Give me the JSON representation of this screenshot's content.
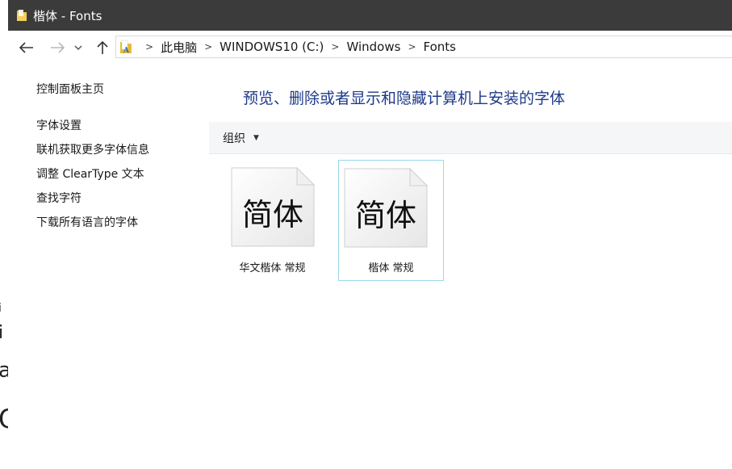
{
  "window": {
    "title": "楷体 - Fonts"
  },
  "background_app": {
    "fragments": [
      "a",
      "i",
      "i",
      "a",
      "O"
    ]
  },
  "navigation": {
    "back_icon": "arrow-left-icon",
    "forward_icon": "arrow-right-icon",
    "recent_icon": "chevron-down-icon",
    "up_icon": "arrow-up-icon",
    "breadcrumbs": [
      "此电脑",
      "WINDOWS10 (C:)",
      "Windows",
      "Fonts"
    ]
  },
  "sidebar": {
    "home": "控制面板主页",
    "items": [
      {
        "label": "字体设置"
      },
      {
        "label": "联机获取更多字体信息"
      },
      {
        "label": "调整 ClearType 文本"
      },
      {
        "label": "查找字符"
      },
      {
        "label": "下载所有语言的字体"
      }
    ]
  },
  "main": {
    "heading": "预览、删除或者显示和隐藏计算机上安装的字体",
    "toolbar": {
      "organize_label": "组织",
      "organize_caret": "▼"
    },
    "fonts": [
      {
        "preview": "简体",
        "label": "华文楷体 常规",
        "selected": false
      },
      {
        "preview": "简体",
        "label": "楷体 常规",
        "selected": true
      }
    ]
  },
  "colors": {
    "titlebar": "#3b3b3b",
    "heading": "#1e3a8a",
    "selection_border": "#99d9ea",
    "folder_yellow": "#e8b93a"
  }
}
